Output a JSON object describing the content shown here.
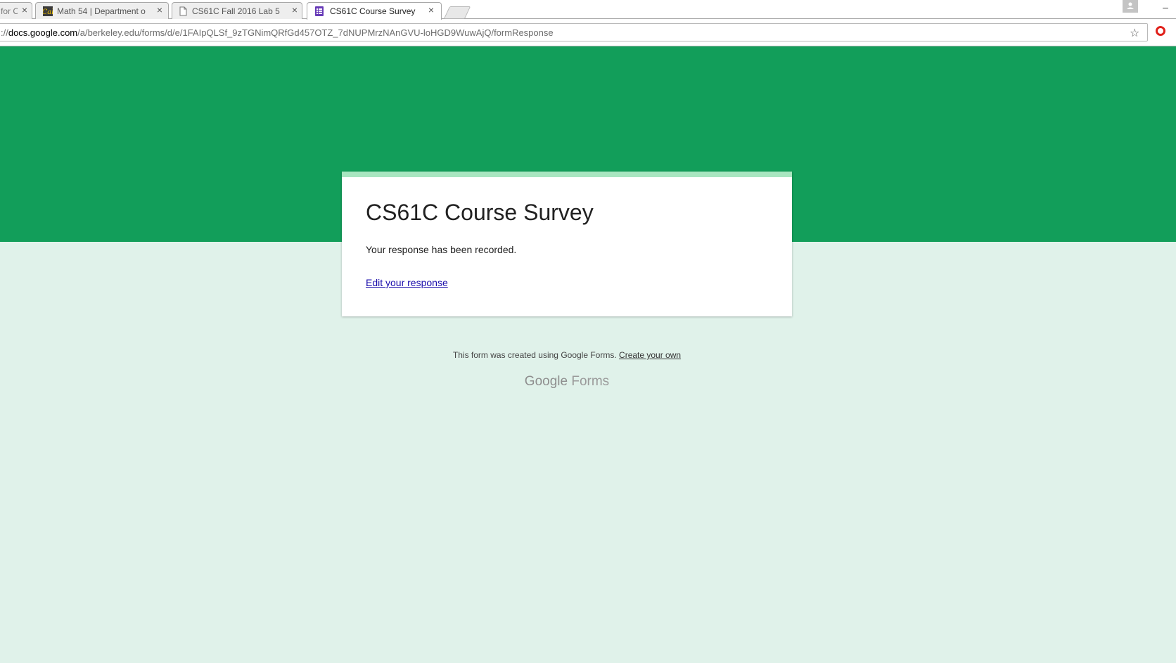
{
  "browser": {
    "tabs": [
      {
        "title": "for C",
        "icon": "page-icon"
      },
      {
        "title": "Math 54 | Department o",
        "icon": "berkeley-logo-icon"
      },
      {
        "title": "CS61C Fall 2016 Lab 5",
        "icon": "document-icon"
      },
      {
        "title": "CS61C Course Survey",
        "icon": "forms-icon",
        "active": true
      }
    ],
    "close_glyph": "×",
    "minimize_glyph": "–",
    "url_prefix": "://",
    "url_host": "docs.google.com",
    "url_path": "/a/berkeley.edu/forms/d/e/1FAIpQLSf_9zTGNimQRfGd457OTZ_7dNUPMrzNAnGVU-loHGD9WuwAjQ/formResponse",
    "star_glyph": "☆"
  },
  "form": {
    "title": "CS61C Course Survey",
    "confirmation": "Your response has been recorded.",
    "edit_link": "Edit your response",
    "theme_color": "#129e5a",
    "background_color": "#e0f2ea"
  },
  "footer": {
    "created_text": "This form was created using Google Forms.",
    "create_link": "Create your own",
    "logo_google": "Google",
    "logo_forms": "Forms"
  }
}
